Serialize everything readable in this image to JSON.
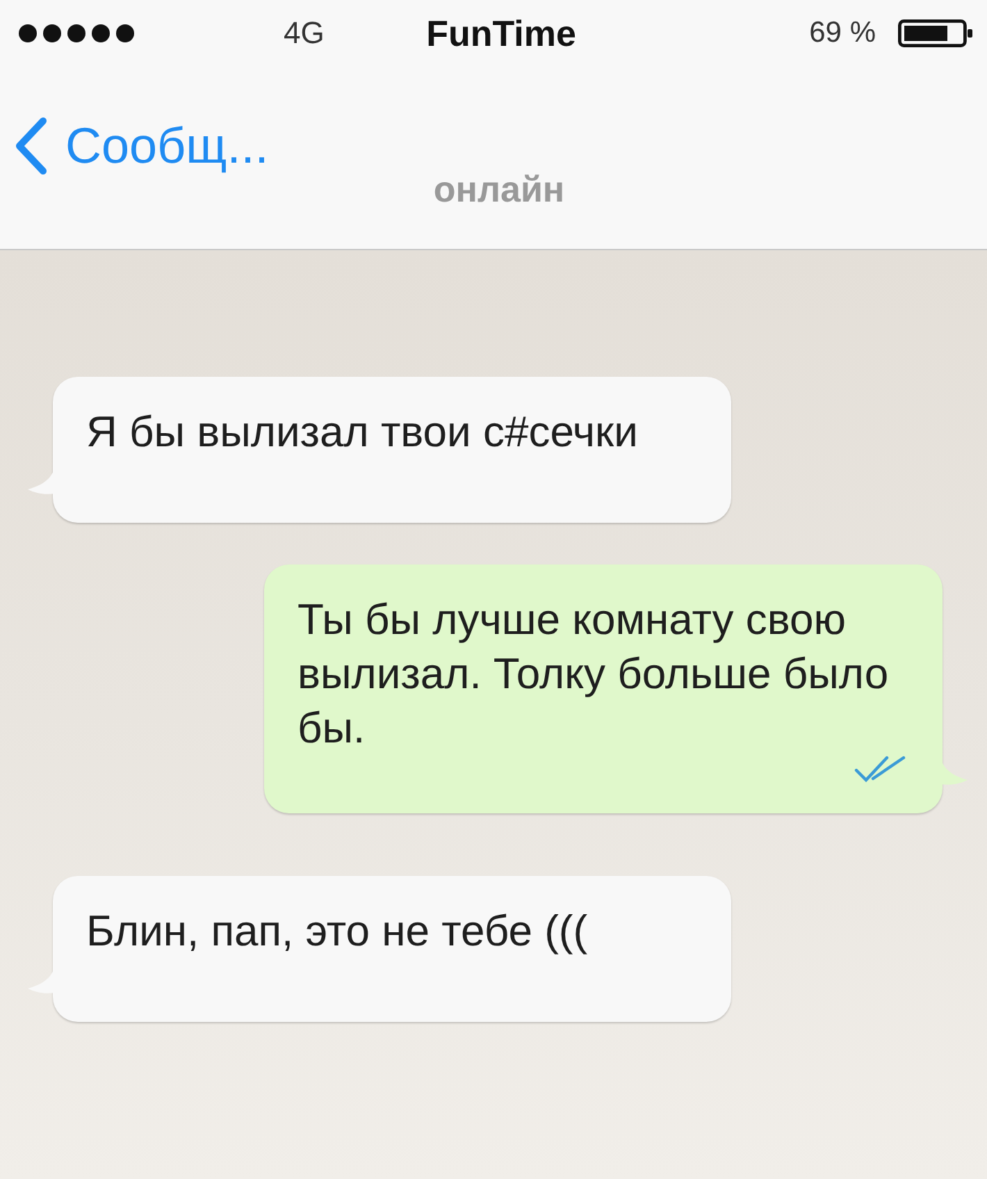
{
  "status_bar": {
    "network": "4G",
    "title": "FunTime",
    "battery": "69 %"
  },
  "nav": {
    "back_label": "Сообщ...",
    "subtitle": "онлайн"
  },
  "messages": [
    {
      "kind": "incoming",
      "text": "Я бы вылизал твои с#сечки"
    },
    {
      "kind": "outgoing",
      "text": "Ты бы лучше комнату свою вылизал. Толку больше было бы.",
      "read": true
    },
    {
      "kind": "incoming",
      "text": "Блин, пап, это не тебе ((("
    }
  ]
}
